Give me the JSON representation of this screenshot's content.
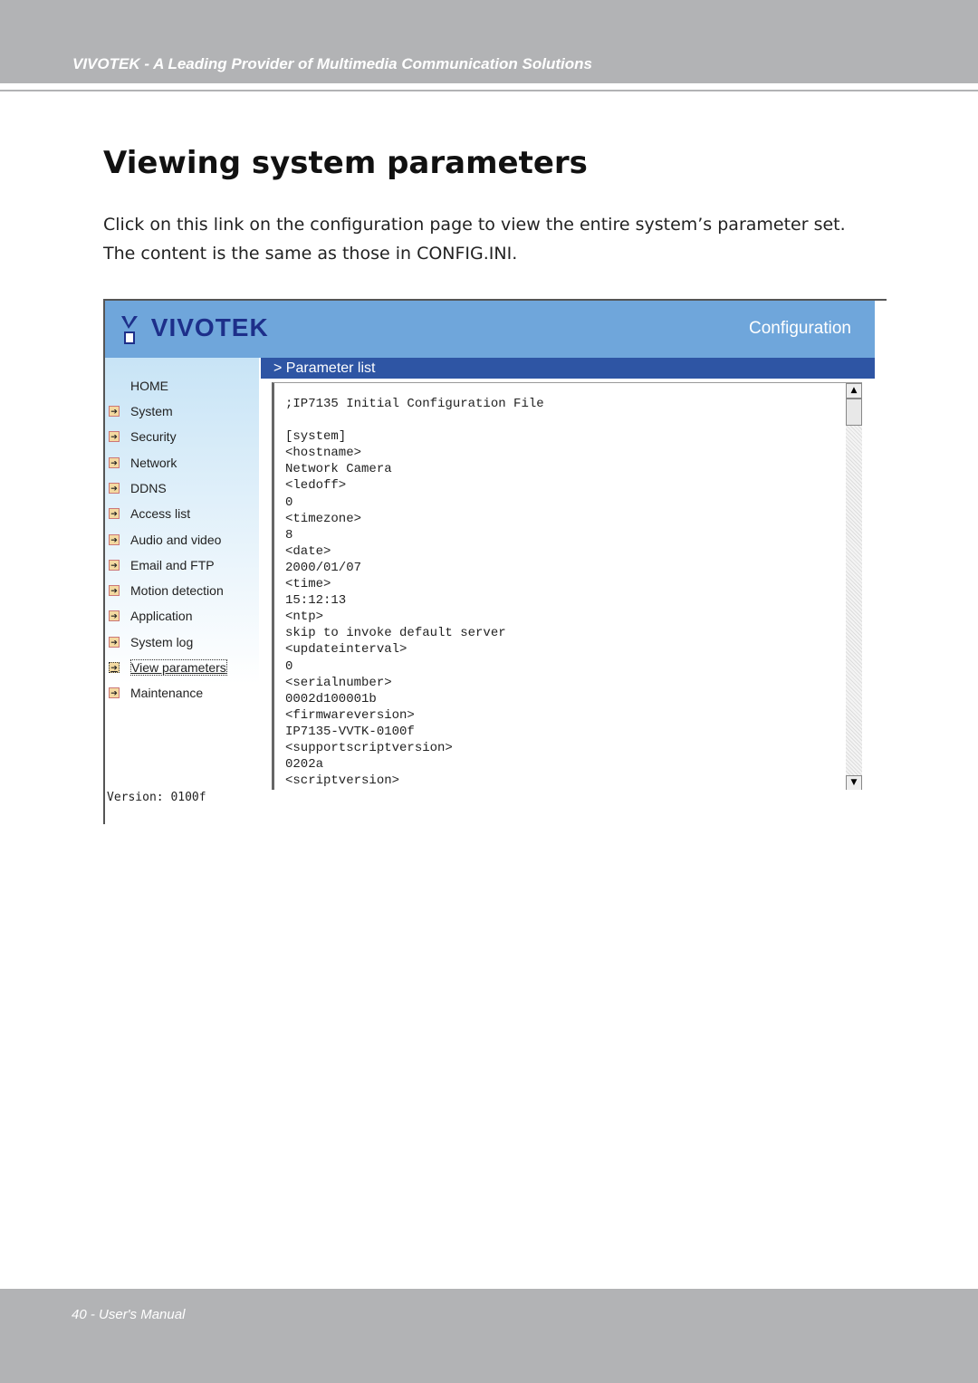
{
  "header": {
    "tagline": "VIVOTEK - A Leading Provider of Multimedia Communication Solutions"
  },
  "title": "Viewing system parameters",
  "paragraph": [
    "Click on this link on the configuration page to view the entire system’s parameter set.",
    "The content is the same as those in CONFIG.INI."
  ],
  "screenshot": {
    "logo": "VIVOTEK",
    "configuration_label": "Configuration",
    "panel_title": "> Parameter list",
    "sidebar": {
      "home": "HOME",
      "items": [
        "System",
        "Security",
        "Network",
        "DDNS",
        "Access list",
        "Audio and video",
        "Email and FTP",
        "Motion detection",
        "Application",
        "System log",
        "View parameters",
        "Maintenance"
      ],
      "selected": "View parameters",
      "version": "Version: 0100f"
    },
    "parameter_text": ";IP7135 Initial Configuration File\n\n[system]\n<hostname>\nNetwork Camera\n<ledoff>\n0\n<timezone>\n8\n<date>\n2000/01/07\n<time>\n15:12:13\n<ntp>\nskip to invoke default server\n<updateinterval>\n0\n<serialnumber>\n0002d100001b\n<firmwareversion>\nIP7135-VVTK-0100f\n<supportscriptversion>\n0202a\n<scriptversion>"
  },
  "footer": {
    "page": "40 - User's Manual"
  }
}
